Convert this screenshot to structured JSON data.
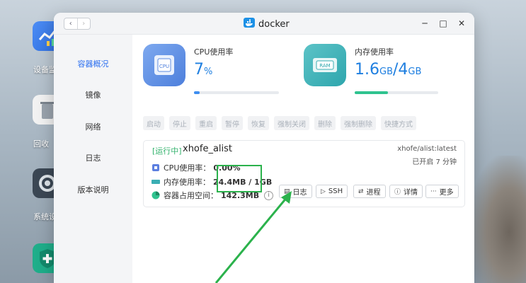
{
  "desktop": {
    "apps": [
      {
        "label": "设备监",
        "icon": "chart-app-icon"
      },
      {
        "label": "回收",
        "icon": "trash-app-icon"
      },
      {
        "label": "系统设",
        "icon": "settings-app-icon"
      },
      {
        "label": "",
        "icon": "shield-plus-app-icon"
      }
    ]
  },
  "window": {
    "title": "docker",
    "nav_back": "‹",
    "nav_forward": "›",
    "controls": {
      "minimize": "─",
      "maximize": "□",
      "close": "✕"
    }
  },
  "sidebar": {
    "items": [
      {
        "label": "容器概况",
        "active": true
      },
      {
        "label": "镜像",
        "active": false
      },
      {
        "label": "网络",
        "active": false
      },
      {
        "label": "日志",
        "active": false
      },
      {
        "label": "版本说明",
        "active": false
      }
    ]
  },
  "stats": {
    "cpu": {
      "label": "CPU使用率",
      "value": "7",
      "unit": "%",
      "percent": 7,
      "bar_color": "#3e8ef0",
      "icon_text": "CPU"
    },
    "memory": {
      "label": "内存使用率",
      "used": "1.6",
      "used_unit": "GB",
      "sep": "/",
      "total": "4",
      "total_unit": "GB",
      "percent": 40,
      "bar_color": "#2fc38f",
      "icon_text": "RAM"
    }
  },
  "toolbar": {
    "buttons": [
      "启动",
      "停止",
      "重启",
      "暂停",
      "恢复",
      "强制关闭",
      "删除",
      "强制删除",
      "快捷方式"
    ]
  },
  "container": {
    "status": "[运行中]",
    "name": "xhofe_alist",
    "image": "xhofe/alist:latest",
    "uptime": "已开启 7 分钟",
    "cpu_label": "CPU使用率：",
    "cpu_value": "0.00%",
    "mem_label": "内存使用率：",
    "mem_value": "24.4MB / 1GB",
    "disk_label": "容器占用空间：",
    "disk_value": "142.3MB",
    "info_glyph": "i",
    "actions": [
      {
        "label": "日志",
        "glyph": "▤",
        "highlighted": true
      },
      {
        "label": "SSH",
        "glyph": "▷",
        "highlighted": false
      },
      {
        "label": "进程",
        "glyph": "⇄",
        "highlighted": false
      },
      {
        "label": "详情",
        "glyph": "ⓘ",
        "highlighted": false
      },
      {
        "label": "更多",
        "glyph": "···",
        "highlighted": false
      }
    ]
  },
  "colors": {
    "accent": "#2b6ff0",
    "running": "#31b26b",
    "annotation": "#2bb24c"
  }
}
